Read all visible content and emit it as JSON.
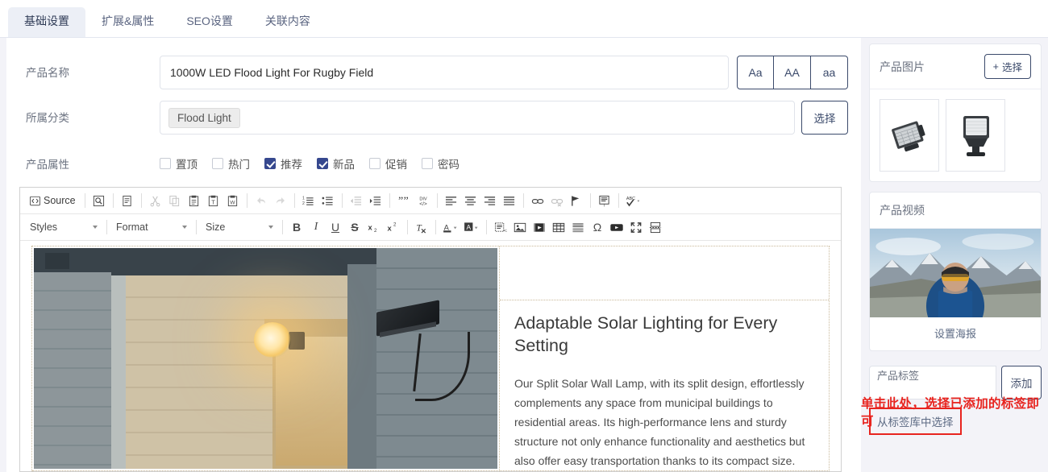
{
  "tabs": [
    {
      "label": "基础设置",
      "active": true
    },
    {
      "label": "扩展&属性",
      "active": false
    },
    {
      "label": "SEO设置",
      "active": false
    },
    {
      "label": "关联内容",
      "active": false
    }
  ],
  "form": {
    "name_label": "产品名称",
    "name_value": "1000W LED Flood Light For Rugby Field",
    "case_buttons": [
      "Aa",
      "AA",
      "aa"
    ],
    "category_label": "所属分类",
    "category_chip": "Flood Light",
    "category_select_label": "选择",
    "attributes_label": "产品属性",
    "attributes": [
      {
        "label": "置顶",
        "checked": false
      },
      {
        "label": "热门",
        "checked": false
      },
      {
        "label": "推荐",
        "checked": true
      },
      {
        "label": "新品",
        "checked": true
      },
      {
        "label": "促销",
        "checked": false
      },
      {
        "label": "密码",
        "checked": false
      }
    ]
  },
  "editor": {
    "source_label": "Source",
    "styles_label": "Styles",
    "format_label": "Format",
    "size_label": "Size",
    "toolbar_row1": [
      "source-button",
      "preview-icon",
      "templates-icon",
      "cut-icon",
      "copy-icon",
      "paste-icon",
      "paste-text-icon",
      "paste-word-icon",
      "undo-icon",
      "redo-icon",
      "numbered-list-icon",
      "bulleted-list-icon",
      "outdent-icon",
      "indent-icon",
      "blockquote-icon",
      "div-container-icon",
      "align-left-icon",
      "align-center-icon",
      "align-right-icon",
      "justify-icon",
      "link-icon",
      "unlink-icon",
      "anchor-icon",
      "show-blocks-icon",
      "spellcheck-icon"
    ],
    "toolbar_row2": [
      "bold-icon",
      "italic-icon",
      "underline-icon",
      "strikethrough-icon",
      "subscript-icon",
      "superscript-icon",
      "remove-format-icon",
      "text-color-icon",
      "background-color-icon",
      "template-code-icon",
      "image-icon",
      "flash-video-icon",
      "table-icon",
      "horizontal-rule-icon",
      "special-char-icon",
      "youtube-icon",
      "maximize-icon",
      "page-break-icon"
    ],
    "content": {
      "heading": "Adaptable Solar Lighting for Every Setting",
      "paragraph": "Our Split Solar Wall Lamp, with its split design, effortlessly complements any space from municipal buildings to residential areas. Its high-performance lens and sturdy structure not only enhance functionality and aesthetics but also offer easy transportation thanks to its compact size."
    }
  },
  "right": {
    "images_title": "产品图片",
    "images_add_label": "选择",
    "images_add_icon": "plus-icon",
    "image_items": [
      "flood-light-thumbnail-1",
      "flood-light-thumbnail-2"
    ],
    "video_title": "产品视频",
    "video_poster_label": "设置海报",
    "tags_title": "产品标签",
    "tags_input_value": "",
    "tags_add_label": "添加",
    "tags_library_label": "从标签库中选择"
  },
  "annotation": {
    "text": "单击此处，选择已添加的标签即可",
    "color": "#e8241f"
  },
  "colors": {
    "accent": "#36488e",
    "outline": "#3b4a6b",
    "page_bg": "#f3f3f8",
    "tab_active_bg": "#eceff6",
    "annotation_red": "#e8241f"
  }
}
